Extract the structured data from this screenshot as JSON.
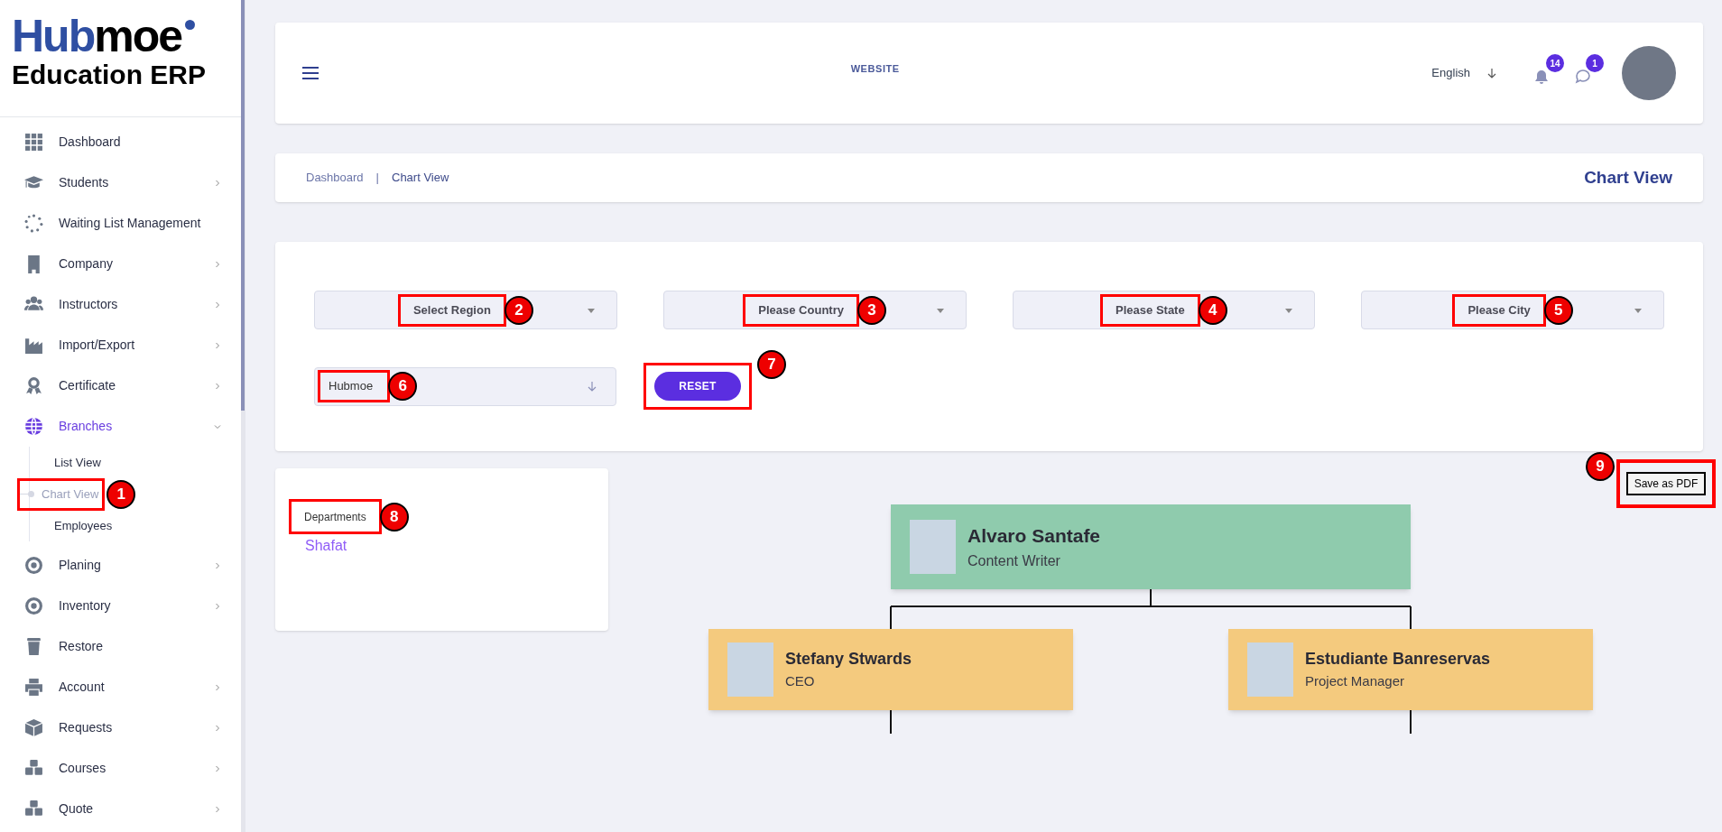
{
  "logo": {
    "brand_first": "Hub",
    "brand_second": "moe",
    "subtitle": "Education ERP"
  },
  "sidebar": {
    "items": [
      {
        "label": "Dashboard",
        "has_arrow": false,
        "selected": false
      },
      {
        "label": "Students",
        "has_arrow": true,
        "expanded": false,
        "selected": false
      },
      {
        "label": "Waiting List Management",
        "has_arrow": false,
        "selected": false
      },
      {
        "label": "Company",
        "has_arrow": true,
        "expanded": false,
        "selected": false
      },
      {
        "label": "Instructors",
        "has_arrow": true,
        "expanded": false,
        "selected": false
      },
      {
        "label": "Import/Export",
        "has_arrow": true,
        "expanded": false,
        "selected": false
      },
      {
        "label": "Certificate",
        "has_arrow": true,
        "expanded": false,
        "selected": false
      },
      {
        "label": "Branches",
        "has_arrow": true,
        "expanded": true,
        "selected": true,
        "children": [
          {
            "label": "List View",
            "selected": false
          },
          {
            "label": "Chart View",
            "selected": true,
            "annotation": "1"
          },
          {
            "label": "Employees",
            "selected": false
          }
        ]
      },
      {
        "label": "Planing",
        "has_arrow": true,
        "expanded": false,
        "selected": false
      },
      {
        "label": "Inventory",
        "has_arrow": true,
        "expanded": false,
        "selected": false
      },
      {
        "label": "Restore",
        "has_arrow": false,
        "selected": false
      },
      {
        "label": "Account",
        "has_arrow": true,
        "expanded": false,
        "selected": false
      },
      {
        "label": "Requests",
        "has_arrow": true,
        "expanded": false,
        "selected": false
      },
      {
        "label": "Courses",
        "has_arrow": true,
        "expanded": false,
        "selected": false
      },
      {
        "label": "Quote",
        "has_arrow": true,
        "expanded": false,
        "selected": false
      }
    ]
  },
  "header": {
    "center_link": "WEBSITE",
    "language": "English",
    "notifications_badge": "14",
    "messages_badge": "1"
  },
  "breadcrumb": {
    "items": [
      "Dashboard",
      "Chart View"
    ],
    "separator": "|",
    "page_title": "Chart View"
  },
  "filters": {
    "selects": [
      {
        "placeholder": "Select Region",
        "annotation": "2"
      },
      {
        "placeholder": "Please Country",
        "annotation": "3"
      },
      {
        "placeholder": "Please State",
        "annotation": "4"
      },
      {
        "placeholder": "Please City",
        "annotation": "5"
      }
    ],
    "company": {
      "value": "Hubmoe",
      "annotation": "6"
    },
    "reset": {
      "label": "RESET",
      "annotation": "7"
    }
  },
  "departments": {
    "title": "Departments",
    "annotation": "8",
    "items": [
      "Shafat"
    ]
  },
  "save_pdf": {
    "label": "Save as PDF",
    "annotation": "9"
  },
  "chart": {
    "root": {
      "name": "Alvaro Santafe",
      "role": "Content Writer",
      "color": "#8fcbad",
      "children": [
        {
          "name": "Stefany Stwards",
          "role": "CEO",
          "color": "#f4ca7e",
          "has_more": true
        },
        {
          "name": "Estudiante Banreservas",
          "role": "Project Manager",
          "color": "#f4ca7e",
          "has_more": true
        }
      ]
    }
  }
}
